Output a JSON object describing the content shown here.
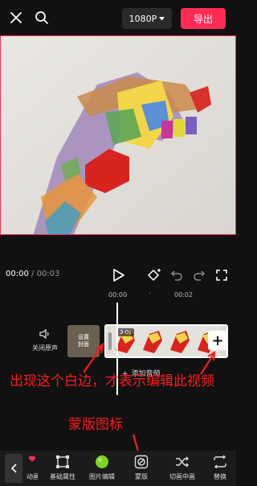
{
  "header": {
    "resolution_label": "1080P",
    "export_label": "导出"
  },
  "player": {
    "current_time": "00:00",
    "separator": "/",
    "total_time": "00:03"
  },
  "ruler": {
    "ticks": [
      "00:00",
      "00:02"
    ]
  },
  "timeline": {
    "mute_label": "关闭原声",
    "cover_label_line1": "设置",
    "cover_label_line2": "封面",
    "clip_duration": "3.0s",
    "add_audio_label": "添加音频"
  },
  "annotations": {
    "white_edge_note": "出现这个白边，才表示编辑此视频",
    "mask_icon_note": "蒙版图标"
  },
  "toolbar": {
    "items": [
      {
        "label": "基础属性",
        "icon": "square-corners-icon"
      },
      {
        "label": "图片编辑",
        "icon": "green-circle-icon"
      },
      {
        "label": "蒙版",
        "icon": "mask-icon"
      },
      {
        "label": "切画中画",
        "icon": "shuffle-icon"
      },
      {
        "label": "替换",
        "icon": "replace-icon"
      }
    ],
    "partial_left_label": "动画"
  },
  "colors": {
    "accent": "#fe2c55",
    "annotation": "#ff1a1a",
    "background": "#111111"
  }
}
